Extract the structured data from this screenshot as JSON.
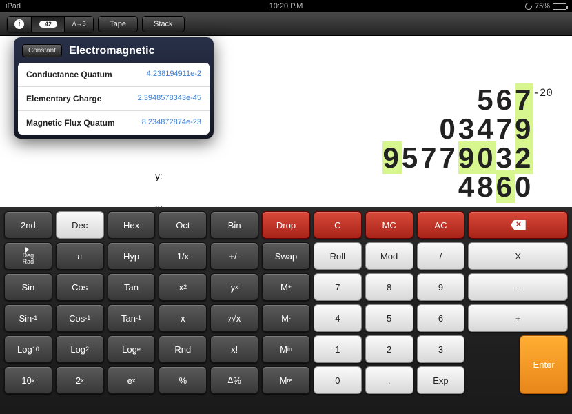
{
  "status": {
    "device": "iPad",
    "time": "10:20 P.M",
    "battery_pct": "75%"
  },
  "toolbar": {
    "info": "i",
    "answer": "42",
    "ab": "A→B",
    "tape": "Tape",
    "stack": "Stack"
  },
  "popover": {
    "badge": "Constant",
    "title": "Electromagnetic",
    "rows": [
      {
        "name": "Conductance Quatum",
        "value": "4.238194911e-2"
      },
      {
        "name": "Elementary Charge",
        "value": "2.3948578343e-45"
      },
      {
        "name": "Magnetic Flux Quatum",
        "value": "8.234872874e-23"
      }
    ]
  },
  "display": {
    "exp": "-20",
    "lines": [
      "567 ",
      "03479 ",
      "95779032 ",
      "4860 "
    ],
    "labels": {
      "y": "y:",
      "x": "x:"
    }
  },
  "keys": {
    "r0": [
      "2nd",
      "Dec",
      "Hex",
      "Oct",
      "Bin",
      "Drop",
      "C",
      "MC",
      "AC",
      "⌫"
    ],
    "r1_deg": "Deg\nRad",
    "r1": [
      "π",
      "Hyp",
      "1/x",
      "+/-",
      "Swap",
      "Roll",
      "Mod",
      "/",
      "X"
    ],
    "r2": [
      "Sin",
      "Cos",
      "Tan",
      "x²",
      "yˣ",
      "M⁺",
      "7",
      "8",
      "9",
      "-"
    ],
    "r3": [
      "Sin⁻¹",
      "Cos⁻¹",
      "Tan⁻¹",
      "x",
      "y√x",
      "M⁻",
      "4",
      "5",
      "6",
      "+"
    ],
    "r4": [
      "Log₁₀",
      "Log₂",
      "Logₑ",
      "Rnd",
      "x!",
      "Mᵢₙ",
      "1",
      "2",
      "3",
      "Enter"
    ],
    "r5": [
      "10ˣ",
      "2ˣ",
      "eˣ",
      "%",
      "Δ %",
      "Mᵣₑ",
      "0",
      ".",
      "Exp"
    ]
  }
}
